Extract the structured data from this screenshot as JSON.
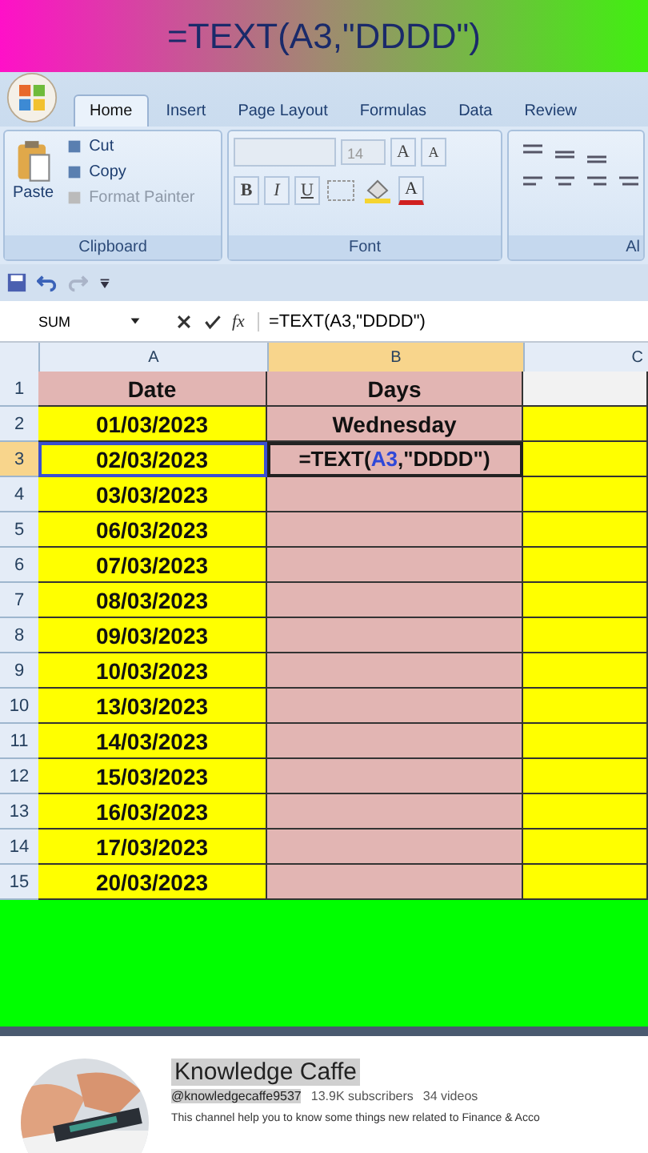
{
  "banner": {
    "title": "=TEXT(A3,\"DDDD\")"
  },
  "ribbon": {
    "tabs": [
      {
        "label": "Home",
        "selected": true
      },
      {
        "label": "Insert",
        "selected": false
      },
      {
        "label": "Page Layout",
        "selected": false
      },
      {
        "label": "Formulas",
        "selected": false
      },
      {
        "label": "Data",
        "selected": false
      },
      {
        "label": "Review",
        "selected": false
      }
    ],
    "clipboard": {
      "paste": "Paste",
      "items": [
        {
          "label": "Cut",
          "disabled": false
        },
        {
          "label": "Copy",
          "disabled": false
        },
        {
          "label": "Format Painter",
          "disabled": true
        }
      ],
      "title": "Clipboard"
    },
    "font": {
      "size": "14",
      "grow": "A",
      "shrink": "A",
      "styles": [
        "B",
        "I",
        "U"
      ],
      "color_letter": "A",
      "title": "Font"
    },
    "alignment": {
      "title": "Al"
    }
  },
  "formula_bar": {
    "name_box": "SUM",
    "fx": "fx",
    "formula": "=TEXT(A3,\"DDDD\")"
  },
  "columns": [
    {
      "label": "A",
      "selected": false
    },
    {
      "label": "B",
      "selected": true
    },
    {
      "label": "C",
      "selected": false
    }
  ],
  "rows": [
    {
      "row": "1",
      "kind": "header",
      "a": "Date",
      "b": "Days",
      "selected": false,
      "referenced": false
    },
    {
      "row": "2",
      "kind": "data",
      "a": "01/03/2023",
      "b": "Wednesday",
      "selected": false,
      "referenced": false
    },
    {
      "row": "3",
      "kind": "editing",
      "a": "02/03/2023",
      "formula": {
        "before": "=TEXT(",
        "reference": "A3",
        "after": ",\"DDDD\")"
      },
      "selected": true,
      "referenced": true
    },
    {
      "row": "4",
      "kind": "data",
      "a": "03/03/2023",
      "selected": false,
      "referenced": false
    },
    {
      "row": "5",
      "kind": "data",
      "a": "06/03/2023",
      "selected": false,
      "referenced": false
    },
    {
      "row": "6",
      "kind": "data",
      "a": "07/03/2023",
      "selected": false,
      "referenced": false
    },
    {
      "row": "7",
      "kind": "data",
      "a": "08/03/2023",
      "selected": false,
      "referenced": false
    },
    {
      "row": "8",
      "kind": "data",
      "a": "09/03/2023",
      "selected": false,
      "referenced": false
    },
    {
      "row": "9",
      "kind": "data",
      "a": "10/03/2023",
      "selected": false,
      "referenced": false
    },
    {
      "row": "10",
      "kind": "data",
      "a": "13/03/2023",
      "selected": false,
      "referenced": false
    },
    {
      "row": "11",
      "kind": "data",
      "a": "14/03/2023",
      "selected": false,
      "referenced": false
    },
    {
      "row": "12",
      "kind": "data",
      "a": "15/03/2023",
      "selected": false,
      "referenced": false
    },
    {
      "row": "13",
      "kind": "data",
      "a": "16/03/2023",
      "selected": false,
      "referenced": false
    },
    {
      "row": "14",
      "kind": "data",
      "a": "17/03/2023",
      "selected": false,
      "referenced": false
    },
    {
      "row": "15",
      "kind": "data",
      "a": "20/03/2023",
      "selected": false,
      "referenced": false
    }
  ],
  "channel": {
    "name": "Knowledge Caffe",
    "handle": "@knowledgecaffe9537",
    "subscribers": "13.9K subscribers",
    "videos": "34 videos",
    "description": "This channel help you to know some things new related to Finance & Acco"
  }
}
